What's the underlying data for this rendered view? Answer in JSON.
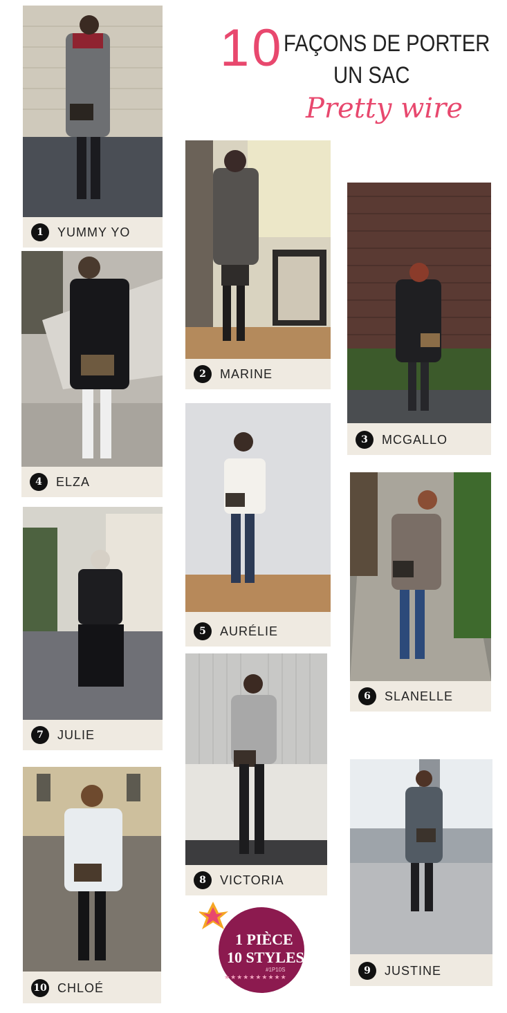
{
  "title": {
    "number": "10",
    "line1": "FAÇONS DE PORTER",
    "line2": "UN SAC",
    "script": "Pretty wire"
  },
  "cards": [
    {
      "num": "1",
      "name": "YUMMY YO"
    },
    {
      "num": "2",
      "name": "MARINE"
    },
    {
      "num": "3",
      "name": "MCGALLO"
    },
    {
      "num": "4",
      "name": "ELZA"
    },
    {
      "num": "5",
      "name": "AURÉLIE"
    },
    {
      "num": "6",
      "name": "SLANELLE"
    },
    {
      "num": "7",
      "name": "JULIE"
    },
    {
      "num": "8",
      "name": "VICTORIA"
    },
    {
      "num": "9",
      "name": "JUSTINE"
    },
    {
      "num": "10",
      "name": "CHLOÉ"
    }
  ],
  "badge": {
    "line1": "1 PIÈCE",
    "line2": "10 STYLES",
    "hashtag": "#1P10S",
    "stars": "★★★★★★★★★★"
  },
  "colors": {
    "accent_pink": "#e8486e",
    "caption_bg": "#efeae1",
    "badge_purple": "#8c1a4f"
  }
}
